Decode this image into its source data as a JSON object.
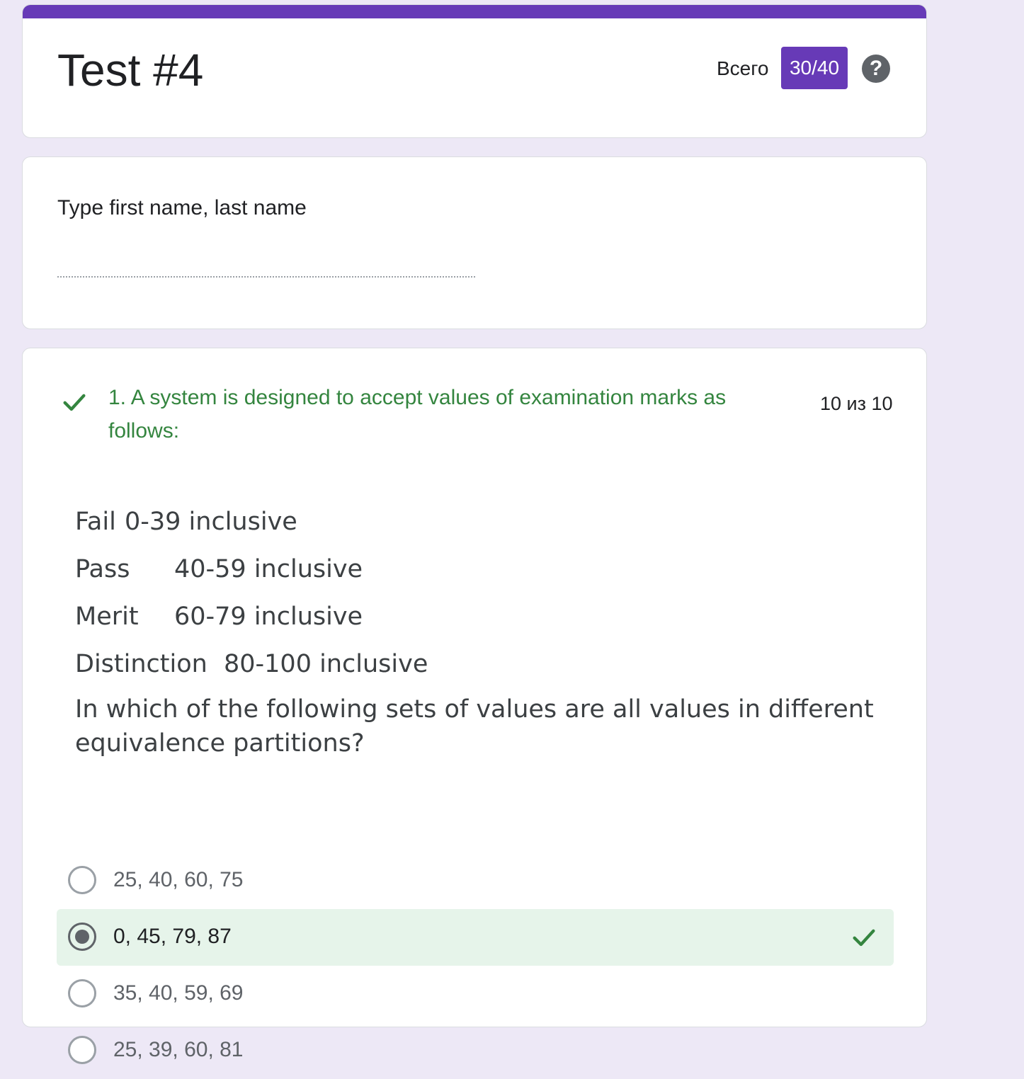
{
  "header": {
    "title": "Test #4",
    "total_label": "Всего",
    "score": "30/40",
    "help_icon": "?",
    "accent_color": "#673ab7"
  },
  "name_question": {
    "label": "Type first name, last name",
    "value": ""
  },
  "question_1": {
    "title": "1. A system is designed to accept values of examination marks as follows:",
    "points": "10 из 10",
    "status": "correct",
    "status_color": "#34853f",
    "image_text": {
      "rows": [
        {
          "name": "Fail",
          "range": "0-39 inclusive"
        },
        {
          "name": "Pass",
          "range": "40-59 inclusive"
        },
        {
          "name": "Merit",
          "range": "60-79 inclusive"
        },
        {
          "name": "Distinction",
          "range": "80-100 inclusive"
        }
      ],
      "stem": "In which of the following sets of values are all values in different equivalence partitions?"
    },
    "options": [
      {
        "label": "25, 40, 60, 75",
        "selected": false
      },
      {
        "label": "0, 45, 79, 87",
        "selected": true,
        "correct": true
      },
      {
        "label": "35, 40, 59, 69",
        "selected": false
      },
      {
        "label": "25, 39, 60, 81",
        "selected": false
      }
    ]
  }
}
